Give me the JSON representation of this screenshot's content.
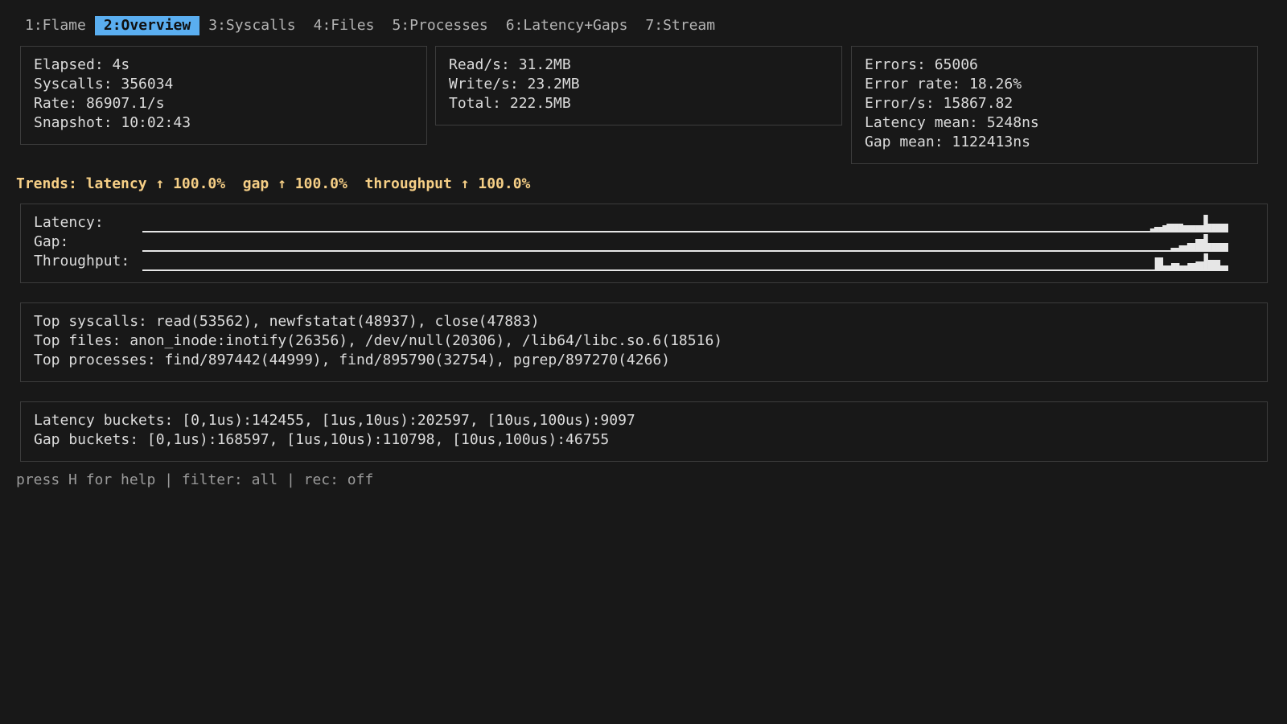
{
  "tabs": [
    {
      "label": "1:Flame",
      "active": false
    },
    {
      "label": "2:Overview",
      "active": true
    },
    {
      "label": "3:Syscalls",
      "active": false
    },
    {
      "label": "4:Files",
      "active": false
    },
    {
      "label": "5:Processes",
      "active": false
    },
    {
      "label": "6:Latency+Gaps",
      "active": false
    },
    {
      "label": "7:Stream",
      "active": false
    }
  ],
  "stats": {
    "elapsed": "Elapsed: 4s",
    "syscalls": "Syscalls: 356034",
    "rate": "Rate: 86907.1/s",
    "snapshot": "Snapshot: 10:02:43"
  },
  "io": {
    "read": "Read/s: 31.2MB",
    "write": "Write/s: 23.2MB",
    "total": "Total: 222.5MB"
  },
  "errors": {
    "errors": "Errors: 65006",
    "error_rate": "Error rate: 18.26%",
    "errors_per_s": "Error/s: 15867.82",
    "latency_mean": "Latency mean: 5248ns",
    "gap_mean": "Gap mean: 1122413ns"
  },
  "trends": "Trends: latency ↑ 100.0%  gap ↑ 100.0%  throughput ↑ 100.0%",
  "sparklines": {
    "latency_label": "Latency:",
    "gap_label": "Gap:",
    "throughput_label": "Throughput:",
    "latency": [
      0,
      0,
      0,
      0,
      0,
      0,
      0,
      0,
      0,
      0,
      0,
      0,
      0,
      0,
      0,
      0,
      0,
      0,
      0,
      0,
      0,
      0,
      0,
      0,
      0,
      0,
      0,
      0,
      0,
      0,
      0,
      0,
      0,
      0,
      0,
      0,
      0,
      0,
      0,
      0,
      0,
      0,
      0,
      0,
      0,
      0,
      0,
      0,
      0,
      0,
      0,
      0,
      0,
      0,
      0,
      0,
      0,
      0,
      0,
      0,
      0,
      0,
      0,
      0,
      0,
      0,
      0,
      0,
      0,
      0,
      0,
      0,
      0,
      0,
      0,
      0,
      0,
      0,
      0,
      0,
      0,
      0,
      0,
      0,
      0,
      0,
      0,
      0,
      0,
      0,
      0,
      0,
      0,
      0,
      0,
      0,
      0,
      0,
      0,
      0,
      0,
      0,
      0,
      0,
      0,
      0,
      0,
      0,
      0,
      0,
      0,
      0,
      0,
      0,
      0,
      0,
      0,
      0,
      0,
      0,
      0,
      0,
      0,
      0,
      0,
      0,
      0,
      0,
      0,
      0,
      0,
      0,
      0,
      0,
      0,
      0,
      0,
      0,
      0,
      0,
      0,
      0,
      0,
      0,
      0,
      0,
      0,
      0,
      0,
      0,
      0,
      0,
      0,
      0,
      0,
      0,
      0,
      0,
      0,
      0,
      0,
      0,
      0,
      0,
      0,
      0,
      0,
      0,
      0,
      0,
      0,
      0,
      0,
      0,
      0,
      0,
      0,
      0,
      0,
      0,
      0,
      0,
      0,
      0,
      0,
      0,
      0,
      0,
      0,
      0,
      0,
      0,
      0,
      0,
      0,
      0,
      0,
      0,
      0,
      0,
      0,
      0,
      0,
      0,
      0,
      0,
      0,
      0,
      0,
      0,
      0,
      0,
      0,
      0,
      0,
      0,
      0,
      0,
      0,
      0,
      0,
      0,
      0,
      0,
      0,
      0,
      0,
      0,
      0,
      0,
      0,
      0,
      0,
      0,
      0,
      0,
      0,
      0,
      0,
      0,
      0,
      0,
      0,
      0,
      0,
      0.15,
      0.25,
      0.25,
      0.35,
      0.45,
      0.45,
      0.45,
      0.45,
      0.35,
      0.35,
      0.35,
      0.35,
      0.35,
      1,
      0.45,
      0.45,
      0.45,
      0.45,
      0.45
    ],
    "gap": [
      0,
      0,
      0,
      0,
      0,
      0,
      0,
      0,
      0,
      0,
      0,
      0,
      0,
      0,
      0,
      0,
      0,
      0,
      0,
      0,
      0,
      0,
      0,
      0,
      0,
      0,
      0,
      0,
      0,
      0,
      0,
      0,
      0,
      0,
      0,
      0,
      0,
      0,
      0,
      0,
      0,
      0,
      0,
      0,
      0,
      0,
      0,
      0,
      0,
      0,
      0,
      0,
      0,
      0,
      0,
      0,
      0,
      0,
      0,
      0,
      0,
      0,
      0,
      0,
      0,
      0,
      0,
      0,
      0,
      0,
      0,
      0,
      0,
      0,
      0,
      0,
      0,
      0,
      0,
      0,
      0,
      0,
      0,
      0,
      0,
      0,
      0,
      0,
      0,
      0,
      0,
      0,
      0,
      0,
      0,
      0,
      0,
      0,
      0,
      0,
      0,
      0,
      0,
      0,
      0,
      0,
      0,
      0,
      0,
      0,
      0,
      0,
      0,
      0,
      0,
      0,
      0,
      0,
      0,
      0,
      0,
      0,
      0,
      0,
      0,
      0,
      0,
      0,
      0,
      0,
      0,
      0,
      0,
      0,
      0,
      0,
      0,
      0,
      0,
      0,
      0,
      0,
      0,
      0,
      0,
      0,
      0,
      0,
      0,
      0,
      0,
      0,
      0,
      0,
      0,
      0,
      0,
      0,
      0,
      0,
      0,
      0,
      0,
      0,
      0,
      0,
      0,
      0,
      0,
      0,
      0,
      0,
      0,
      0,
      0,
      0,
      0,
      0,
      0,
      0,
      0,
      0,
      0,
      0,
      0,
      0,
      0,
      0,
      0,
      0,
      0,
      0,
      0,
      0,
      0,
      0,
      0,
      0,
      0,
      0,
      0,
      0,
      0,
      0,
      0,
      0,
      0,
      0,
      0,
      0,
      0,
      0,
      0,
      0,
      0,
      0,
      0,
      0,
      0,
      0,
      0,
      0,
      0,
      0,
      0,
      0,
      0,
      0,
      0,
      0,
      0,
      0,
      0,
      0,
      0,
      0,
      0,
      0,
      0,
      0,
      0,
      0,
      0,
      0,
      0,
      0,
      0,
      0,
      0,
      0,
      0.15,
      0.15,
      0.3,
      0.3,
      0.45,
      0.45,
      0.7,
      0.7,
      1,
      0.45,
      0.45,
      0.45,
      0.45,
      0.45
    ],
    "throughput": [
      0,
      0,
      0,
      0,
      0,
      0,
      0,
      0,
      0,
      0,
      0,
      0,
      0,
      0,
      0,
      0,
      0,
      0,
      0,
      0,
      0,
      0,
      0,
      0,
      0,
      0,
      0,
      0,
      0,
      0,
      0,
      0,
      0,
      0,
      0,
      0,
      0,
      0,
      0,
      0,
      0,
      0,
      0,
      0,
      0,
      0,
      0,
      0,
      0,
      0,
      0,
      0,
      0,
      0,
      0,
      0,
      0,
      0,
      0,
      0,
      0,
      0,
      0,
      0,
      0,
      0,
      0,
      0,
      0,
      0,
      0,
      0,
      0,
      0,
      0,
      0,
      0,
      0,
      0,
      0,
      0,
      0,
      0,
      0,
      0,
      0,
      0,
      0,
      0,
      0,
      0,
      0,
      0,
      0,
      0,
      0,
      0,
      0,
      0,
      0,
      0,
      0,
      0,
      0,
      0,
      0,
      0,
      0,
      0,
      0,
      0,
      0,
      0,
      0,
      0,
      0,
      0,
      0,
      0,
      0,
      0,
      0,
      0,
      0,
      0,
      0,
      0,
      0,
      0,
      0,
      0,
      0,
      0,
      0,
      0,
      0,
      0,
      0,
      0,
      0,
      0,
      0,
      0,
      0,
      0,
      0,
      0,
      0,
      0,
      0,
      0,
      0,
      0,
      0,
      0,
      0,
      0,
      0,
      0,
      0,
      0,
      0,
      0,
      0,
      0,
      0,
      0,
      0,
      0,
      0,
      0,
      0,
      0,
      0,
      0,
      0,
      0,
      0,
      0,
      0,
      0,
      0,
      0,
      0,
      0,
      0,
      0,
      0,
      0,
      0,
      0,
      0,
      0,
      0,
      0,
      0,
      0,
      0,
      0,
      0,
      0,
      0,
      0,
      0,
      0,
      0,
      0,
      0,
      0,
      0,
      0,
      0,
      0,
      0,
      0,
      0,
      0,
      0,
      0,
      0,
      0,
      0,
      0,
      0,
      0,
      0,
      0,
      0,
      0,
      0,
      0,
      0,
      0,
      0,
      0,
      0,
      0,
      0,
      0,
      0,
      0,
      0,
      0,
      0,
      0,
      0,
      0,
      0,
      0.75,
      0.75,
      0.25,
      0.25,
      0.4,
      0.4,
      0.25,
      0.25,
      0.4,
      0.4,
      0.5,
      0.5,
      1,
      0.6,
      0.6,
      0.6,
      0.25,
      0.25
    ]
  },
  "top": {
    "syscalls": "Top syscalls: read(53562), newfstatat(48937), close(47883)",
    "files": "Top files: anon_inode:inotify(26356), /dev/null(20306), /lib64/libc.so.6(18516)",
    "processes": "Top processes: find/897442(44999), find/895790(32754), pgrep/897270(4266)"
  },
  "buckets": {
    "latency": "Latency buckets: [0,1us):142455, [1us,10us):202597, [10us,100us):9097",
    "gap": "Gap buckets: [0,1us):168597, [1us,10us):110798, [10us,100us):46755"
  },
  "footer": "press H for help | filter: all | rec: off"
}
